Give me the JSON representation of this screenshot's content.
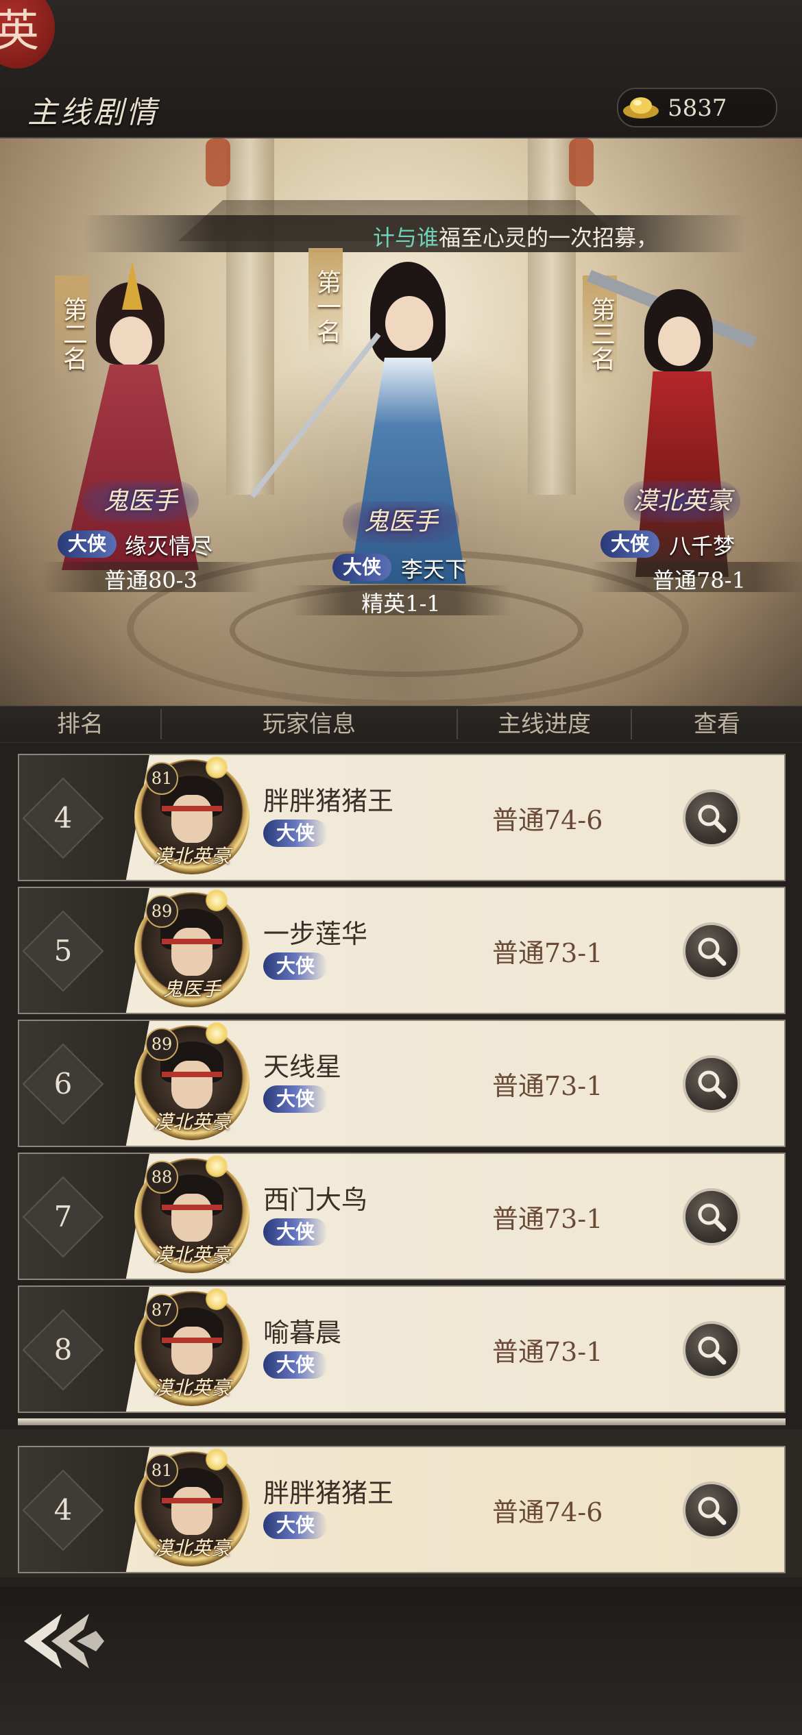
{
  "header": {
    "emblem_glyph": "英",
    "title": "主线剧情",
    "currency": {
      "icon": "gold-ingot-icon",
      "value": "5837"
    }
  },
  "announcement": {
    "name": "计与谁",
    "text": "福至心灵的一次招募，"
  },
  "top3": [
    {
      "rank_label": "第一名",
      "guild": "鬼医手",
      "title": "大侠",
      "name": "李天下",
      "progress": "精英1-1"
    },
    {
      "rank_label": "第二名",
      "guild": "鬼医手",
      "title": "大侠",
      "name": "缘灭情尽",
      "progress": "普通80-3"
    },
    {
      "rank_label": "第三名",
      "guild": "漠北英豪",
      "title": "大侠",
      "name": "八千梦",
      "progress": "普通78-1"
    }
  ],
  "table_headers": [
    "排名",
    "玩家信息",
    "主线进度",
    "查看"
  ],
  "rows": [
    {
      "rank": "4",
      "level": "81",
      "guild": "漠北英豪",
      "name": "胖胖猪猪王",
      "title": "大侠",
      "progress": "普通74-6"
    },
    {
      "rank": "5",
      "level": "89",
      "guild": "鬼医手",
      "name": "一步莲华",
      "title": "大侠",
      "progress": "普通73-1"
    },
    {
      "rank": "6",
      "level": "89",
      "guild": "漠北英豪",
      "name": "天线星",
      "title": "大侠",
      "progress": "普通73-1"
    },
    {
      "rank": "7",
      "level": "88",
      "guild": "漠北英豪",
      "name": "西门大鸟",
      "title": "大侠",
      "progress": "普通73-1"
    },
    {
      "rank": "8",
      "level": "87",
      "guild": "漠北英豪",
      "name": "喻暮晨",
      "title": "大侠",
      "progress": "普通73-1"
    }
  ],
  "my_row": {
    "rank": "4",
    "level": "81",
    "guild": "漠北英豪",
    "name": "胖胖猪猪王",
    "title": "大侠",
    "progress": "普通74-6"
  },
  "colors": {
    "accent_name": "#6fd2b8",
    "title_badge": "#2a3a7a",
    "progress_text": "#6a4a36"
  }
}
